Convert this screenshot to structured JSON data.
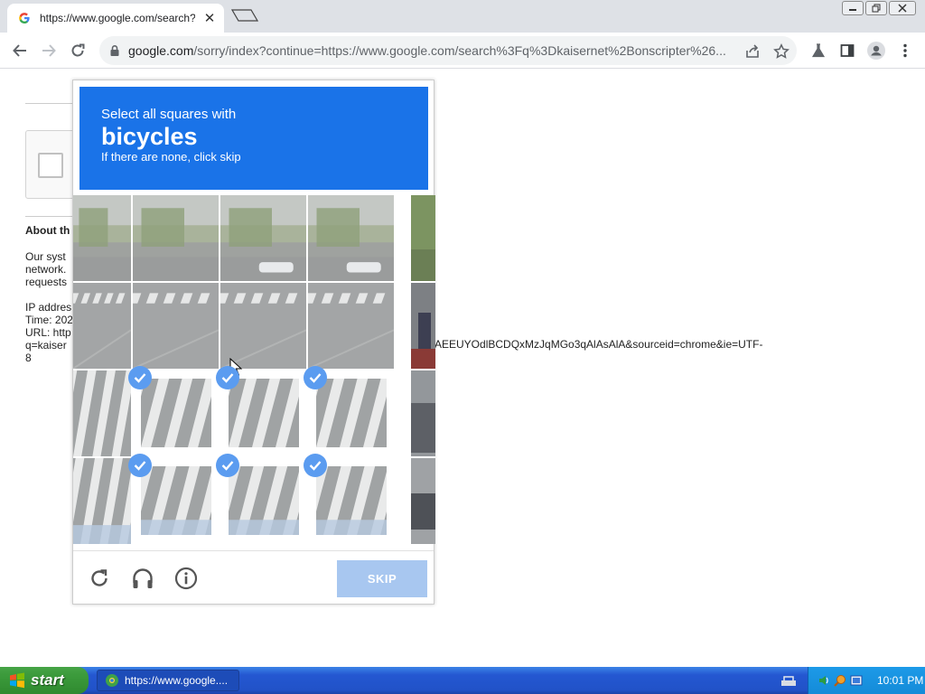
{
  "browser": {
    "tab_title": "https://www.google.com/search?q=",
    "tab_close": "✕",
    "url_host": "google.com",
    "url_path": "/sorry/index?continue=https://www.google.com/search%3Fq%3Dkaisernet%2Bonscripter%26..."
  },
  "page": {
    "about_heading": "About th",
    "lines": [
      "Our syst",
      "network.",
      "requests",
      "",
      "IP addres",
      "Time: 202",
      "URL: http",
      "q=kaiser",
      "8"
    ],
    "url_tail": "AEEUYOdlBCDQxMzJqMGo3qAlAsAlA&sourceid=chrome&ie=UTF-"
  },
  "captcha": {
    "instruction_line1": "Select all squares with",
    "target": "bicycles",
    "instruction_line3": "If there are none, click skip",
    "skip_label": "SKIP",
    "tiles_selected": [
      false,
      false,
      false,
      false,
      false,
      false,
      false,
      false,
      false,
      true,
      true,
      true,
      false,
      true,
      true,
      true
    ]
  },
  "taskbar": {
    "start_label": "start",
    "task_label": "https://www.google....",
    "clock": "10:01 PM"
  },
  "colors": {
    "header_blue": "#1a73e8",
    "check_blue": "#5b9cf0",
    "skip_disabled": "#a8c7f0"
  }
}
